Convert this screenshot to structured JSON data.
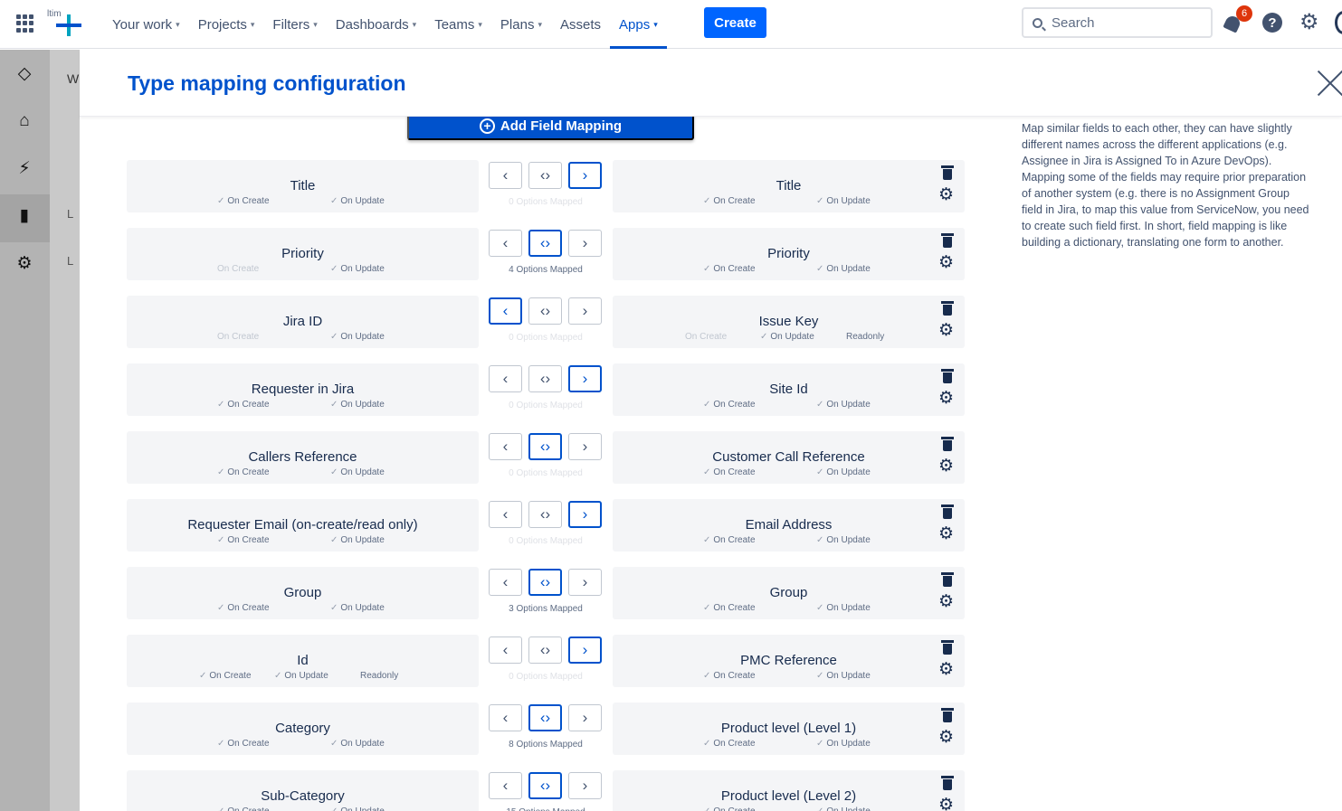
{
  "nav": {
    "items": [
      {
        "label": "Your work",
        "chevron": true
      },
      {
        "label": "Projects",
        "chevron": true
      },
      {
        "label": "Filters",
        "chevron": true
      },
      {
        "label": "Dashboards",
        "chevron": true
      },
      {
        "label": "Teams",
        "chevron": true
      },
      {
        "label": "Plans",
        "chevron": true
      },
      {
        "label": "Assets",
        "chevron": false
      },
      {
        "label": "Apps",
        "chevron": true,
        "active": true
      }
    ],
    "create_label": "Create",
    "search_placeholder": "Search",
    "notification_count": "6",
    "logo_text": "ltim"
  },
  "sidebar": {
    "icons": [
      "exalate-icon",
      "home-icon",
      "lightning-icon",
      "bar-chart-icon",
      "gear-icon"
    ],
    "secondary_letters": [
      "W",
      "L",
      "L"
    ]
  },
  "modal": {
    "title": "Type mapping configuration",
    "add_button_label": "Add Field Mapping",
    "help_text": "Map similar fields to each other, they can have slightly different names across the different applications (e.g. Assignee in Jira is Assigned To in Azure DevOps). Mapping some of the fields may require prior preparation of another system (e.g. there is no Assignment Group field in Jira, to map this value from ServiceNow, you need to create such field first. In short, field mapping is like building a dictionary, translating one form to another.",
    "on_create_label": "On Create",
    "on_update_label": "On Update",
    "readonly_label": "Readonly",
    "rows": [
      {
        "left": "Title",
        "right": "Title",
        "direction": "right",
        "mapped": "0 Options Mapped",
        "left_create": true,
        "left_readonly": false,
        "right_create": true,
        "right_readonly": false
      },
      {
        "left": "Priority",
        "right": "Priority",
        "direction": "both",
        "mapped": "4 Options Mapped",
        "left_create": false,
        "left_readonly": false,
        "right_create": true,
        "right_readonly": false
      },
      {
        "left": "Jira ID",
        "right": "Issue Key",
        "direction": "left",
        "mapped": "0 Options Mapped",
        "left_create": false,
        "left_readonly": false,
        "right_create": false,
        "right_readonly": true
      },
      {
        "left": "Requester in Jira",
        "right": "Site Id",
        "direction": "right",
        "mapped": "0 Options Mapped",
        "left_create": true,
        "left_readonly": false,
        "right_create": true,
        "right_readonly": false
      },
      {
        "left": "Callers Reference",
        "right": "Customer Call Reference",
        "direction": "both",
        "mapped": "0 Options Mapped",
        "left_create": true,
        "left_readonly": false,
        "right_create": true,
        "right_readonly": false
      },
      {
        "left": "Requester Email (on-create/read only)",
        "right": "Email Address",
        "direction": "right",
        "mapped": "0 Options Mapped",
        "left_create": true,
        "left_readonly": false,
        "right_create": true,
        "right_readonly": false
      },
      {
        "left": "Group",
        "right": "Group",
        "direction": "both",
        "mapped": "3 Options Mapped",
        "left_create": true,
        "left_readonly": false,
        "right_create": true,
        "right_readonly": false
      },
      {
        "left": "Id",
        "right": "PMC Reference",
        "direction": "right",
        "mapped": "0 Options Mapped",
        "left_create": true,
        "left_readonly": true,
        "right_create": true,
        "right_readonly": false
      },
      {
        "left": "Category",
        "right": "Product level (Level 1)",
        "direction": "both",
        "mapped": "8 Options Mapped",
        "left_create": true,
        "left_readonly": false,
        "right_create": true,
        "right_readonly": false
      },
      {
        "left": "Sub-Category",
        "right": "Product level (Level 2)",
        "direction": "both",
        "mapped": "15 Options Mapped",
        "left_create": true,
        "left_readonly": false,
        "right_create": true,
        "right_readonly": false
      }
    ]
  },
  "colors": {
    "brand": "#0052cc",
    "create_button": "#0065ff",
    "badge": "#de350b",
    "card_bg": "#f4f5f7",
    "sidebar_bg": "#b3b3b3"
  }
}
